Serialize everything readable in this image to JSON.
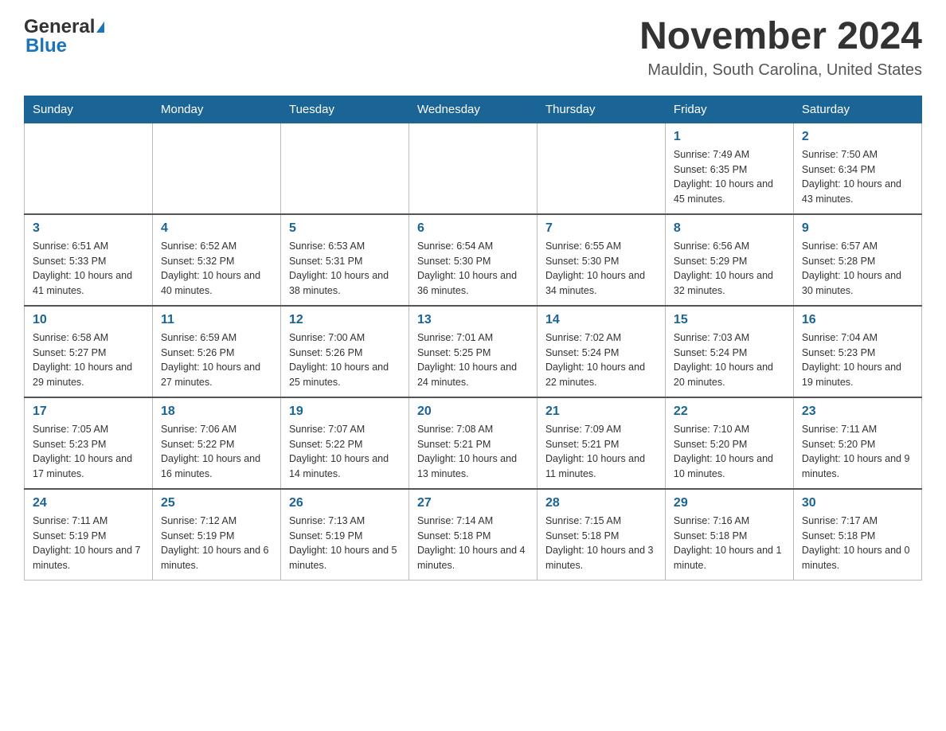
{
  "logo": {
    "text1": "General",
    "text2": "Blue"
  },
  "title": "November 2024",
  "location": "Mauldin, South Carolina, United States",
  "days_of_week": [
    "Sunday",
    "Monday",
    "Tuesday",
    "Wednesday",
    "Thursday",
    "Friday",
    "Saturday"
  ],
  "weeks": [
    [
      {
        "num": "",
        "info": ""
      },
      {
        "num": "",
        "info": ""
      },
      {
        "num": "",
        "info": ""
      },
      {
        "num": "",
        "info": ""
      },
      {
        "num": "",
        "info": ""
      },
      {
        "num": "1",
        "info": "Sunrise: 7:49 AM\nSunset: 6:35 PM\nDaylight: 10 hours and 45 minutes."
      },
      {
        "num": "2",
        "info": "Sunrise: 7:50 AM\nSunset: 6:34 PM\nDaylight: 10 hours and 43 minutes."
      }
    ],
    [
      {
        "num": "3",
        "info": "Sunrise: 6:51 AM\nSunset: 5:33 PM\nDaylight: 10 hours and 41 minutes."
      },
      {
        "num": "4",
        "info": "Sunrise: 6:52 AM\nSunset: 5:32 PM\nDaylight: 10 hours and 40 minutes."
      },
      {
        "num": "5",
        "info": "Sunrise: 6:53 AM\nSunset: 5:31 PM\nDaylight: 10 hours and 38 minutes."
      },
      {
        "num": "6",
        "info": "Sunrise: 6:54 AM\nSunset: 5:30 PM\nDaylight: 10 hours and 36 minutes."
      },
      {
        "num": "7",
        "info": "Sunrise: 6:55 AM\nSunset: 5:30 PM\nDaylight: 10 hours and 34 minutes."
      },
      {
        "num": "8",
        "info": "Sunrise: 6:56 AM\nSunset: 5:29 PM\nDaylight: 10 hours and 32 minutes."
      },
      {
        "num": "9",
        "info": "Sunrise: 6:57 AM\nSunset: 5:28 PM\nDaylight: 10 hours and 30 minutes."
      }
    ],
    [
      {
        "num": "10",
        "info": "Sunrise: 6:58 AM\nSunset: 5:27 PM\nDaylight: 10 hours and 29 minutes."
      },
      {
        "num": "11",
        "info": "Sunrise: 6:59 AM\nSunset: 5:26 PM\nDaylight: 10 hours and 27 minutes."
      },
      {
        "num": "12",
        "info": "Sunrise: 7:00 AM\nSunset: 5:26 PM\nDaylight: 10 hours and 25 minutes."
      },
      {
        "num": "13",
        "info": "Sunrise: 7:01 AM\nSunset: 5:25 PM\nDaylight: 10 hours and 24 minutes."
      },
      {
        "num": "14",
        "info": "Sunrise: 7:02 AM\nSunset: 5:24 PM\nDaylight: 10 hours and 22 minutes."
      },
      {
        "num": "15",
        "info": "Sunrise: 7:03 AM\nSunset: 5:24 PM\nDaylight: 10 hours and 20 minutes."
      },
      {
        "num": "16",
        "info": "Sunrise: 7:04 AM\nSunset: 5:23 PM\nDaylight: 10 hours and 19 minutes."
      }
    ],
    [
      {
        "num": "17",
        "info": "Sunrise: 7:05 AM\nSunset: 5:23 PM\nDaylight: 10 hours and 17 minutes."
      },
      {
        "num": "18",
        "info": "Sunrise: 7:06 AM\nSunset: 5:22 PM\nDaylight: 10 hours and 16 minutes."
      },
      {
        "num": "19",
        "info": "Sunrise: 7:07 AM\nSunset: 5:22 PM\nDaylight: 10 hours and 14 minutes."
      },
      {
        "num": "20",
        "info": "Sunrise: 7:08 AM\nSunset: 5:21 PM\nDaylight: 10 hours and 13 minutes."
      },
      {
        "num": "21",
        "info": "Sunrise: 7:09 AM\nSunset: 5:21 PM\nDaylight: 10 hours and 11 minutes."
      },
      {
        "num": "22",
        "info": "Sunrise: 7:10 AM\nSunset: 5:20 PM\nDaylight: 10 hours and 10 minutes."
      },
      {
        "num": "23",
        "info": "Sunrise: 7:11 AM\nSunset: 5:20 PM\nDaylight: 10 hours and 9 minutes."
      }
    ],
    [
      {
        "num": "24",
        "info": "Sunrise: 7:11 AM\nSunset: 5:19 PM\nDaylight: 10 hours and 7 minutes."
      },
      {
        "num": "25",
        "info": "Sunrise: 7:12 AM\nSunset: 5:19 PM\nDaylight: 10 hours and 6 minutes."
      },
      {
        "num": "26",
        "info": "Sunrise: 7:13 AM\nSunset: 5:19 PM\nDaylight: 10 hours and 5 minutes."
      },
      {
        "num": "27",
        "info": "Sunrise: 7:14 AM\nSunset: 5:18 PM\nDaylight: 10 hours and 4 minutes."
      },
      {
        "num": "28",
        "info": "Sunrise: 7:15 AM\nSunset: 5:18 PM\nDaylight: 10 hours and 3 minutes."
      },
      {
        "num": "29",
        "info": "Sunrise: 7:16 AM\nSunset: 5:18 PM\nDaylight: 10 hours and 1 minute."
      },
      {
        "num": "30",
        "info": "Sunrise: 7:17 AM\nSunset: 5:18 PM\nDaylight: 10 hours and 0 minutes."
      }
    ]
  ]
}
